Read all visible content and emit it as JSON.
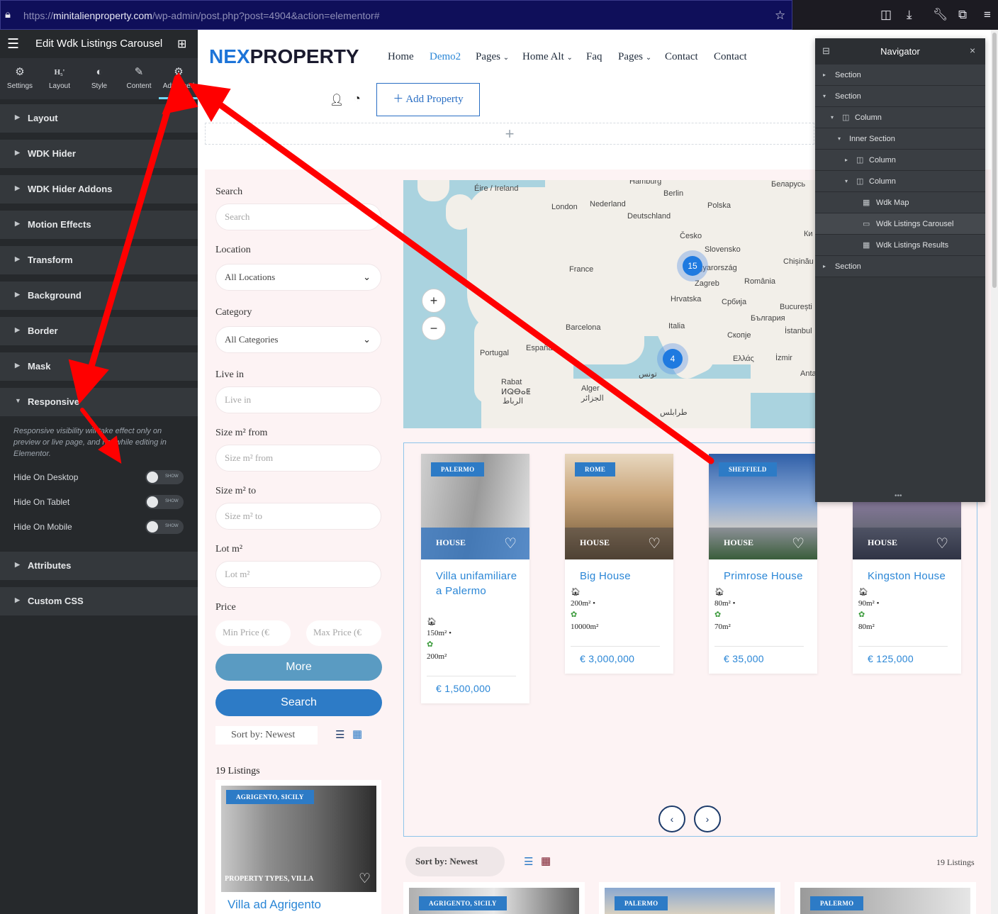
{
  "browser": {
    "url_prefix": "https://",
    "url_domain": "minitalienproperty.com",
    "url_path": "/wp-admin/post.php?post=4904&action=elementor#"
  },
  "panel": {
    "title": "Edit Wdk Listings Carousel",
    "tabs": [
      {
        "label": "Settings",
        "icon": "gears-icon"
      },
      {
        "label": "Layout",
        "icon": "heading-icon"
      },
      {
        "label": "Style",
        "icon": "half-circle-icon"
      },
      {
        "label": "Content",
        "icon": "pencil-icon"
      },
      {
        "label": "Advanced",
        "icon": "gear-icon"
      }
    ],
    "sections": [
      "Layout",
      "WDK Hider",
      "WDK Hider Addons",
      "Motion Effects",
      "Transform",
      "Background",
      "Border",
      "Mask",
      "Responsive",
      "Attributes",
      "Custom CSS"
    ],
    "responsive_note": "Responsive visibility will take effect only on preview or live page, and not while editing in Elementor.",
    "controls": [
      {
        "label": "Hide On Desktop",
        "toggle": "SHOW"
      },
      {
        "label": "Hide On Tablet",
        "toggle": "SHOW"
      },
      {
        "label": "Hide On Mobile",
        "toggle": "SHOW"
      }
    ]
  },
  "site": {
    "logo_a": "NEX",
    "logo_b": "PROPERTY",
    "nav": [
      "Home",
      "Demo2",
      "Pages",
      "Home Alt",
      "Faq",
      "Pages",
      "Contact",
      "Contact"
    ],
    "add_property": "Add Property"
  },
  "filters": {
    "search_label": "Search",
    "search_placeholder": "Search",
    "location_label": "Location",
    "location_value": "All Locations",
    "category_label": "Category",
    "category_value": "All Categories",
    "livein_label": "Live in",
    "livein_placeholder": "Live in",
    "sizefrom_label": "Size m² from",
    "sizefrom_placeholder": "Size m² from",
    "sizeto_label": "Size m² to",
    "sizeto_placeholder": "Size m² to",
    "lot_label": "Lot m²",
    "lot_placeholder": "Lot m²",
    "price_label": "Price",
    "min_price": "Min Price (€",
    "max_price": "Max Price (€",
    "more_button": "More",
    "search_button": "Search",
    "sort": "Sort by: Newest",
    "count": "19 Listings"
  },
  "left_listing": {
    "badge": "AGRIGENTO, SICILY",
    "type": "PROPERTY TYPES, VILLA",
    "title": "Villa ad Agrigento"
  },
  "map": {
    "labels": [
      "Éire / Ireland",
      "Hamburg",
      "Berlin",
      "Беларусь",
      "London",
      "Nederland",
      "Polska",
      "Deutschland",
      "Česko",
      "Slovensko",
      "Chișinău",
      "France",
      "Magyarország",
      "Zagreb",
      "România",
      "Hrvatska",
      "Србија",
      "București",
      "България",
      "Barcelona",
      "Italia",
      "Скопје",
      "İstanbul",
      "Portugal",
      "España",
      "Ελλάς",
      "İzmir",
      "Rabat",
      "ⵍⵕⴱⴰⵟ",
      "الرباط",
      "Alger",
      "الجزائر",
      "تونس",
      "طرابلس",
      "Anta",
      "Ки"
    ],
    "clusters": [
      "15",
      "4"
    ],
    "zoom_in": "+",
    "zoom_out": "−"
  },
  "carousel": {
    "cards": [
      {
        "badge": "PALERMO",
        "type": "HOUSE",
        "title": "Villa unifamiliare a Palermo",
        "size": "150m² •",
        "lot": "200m²",
        "price": "€ 1,500,000"
      },
      {
        "badge": "ROME",
        "type": "HOUSE",
        "title": "Big House",
        "size": "200m² •",
        "lot": "10000m²",
        "price": "€ 3,000,000"
      },
      {
        "badge": "SHEFFIELD",
        "type": "HOUSE",
        "title": "Primrose House",
        "size": "80m² •",
        "lot": "70m²",
        "price": "€ 35,000"
      },
      {
        "badge": "",
        "type": "HOUSE",
        "title": "Kingston House",
        "size": "90m² •",
        "lot": "80m²",
        "price": "€ 125,000"
      }
    ],
    "prev": "‹",
    "next": "›"
  },
  "results": {
    "sort": "Sort by: Newest",
    "count": "19 Listings",
    "badges": [
      "AGRIGENTO, SICILY",
      "PALERMO",
      "PALERMO"
    ]
  },
  "navigator": {
    "title": "Navigator",
    "rows": [
      {
        "label": "Section",
        "arrow": "▸"
      },
      {
        "label": "Section",
        "arrow": "▾"
      },
      {
        "label": "Column",
        "arrow": "▾",
        "icon": "◫"
      },
      {
        "label": "Inner Section",
        "arrow": "▾"
      },
      {
        "label": "Column",
        "arrow": "▸",
        "icon": "◫"
      },
      {
        "label": "Column",
        "arrow": "▾",
        "icon": "◫"
      },
      {
        "label": "Wdk Map",
        "icon": "▦"
      },
      {
        "label": "Wdk Listings Carousel",
        "icon": "▭"
      },
      {
        "label": "Wdk Listings Results",
        "icon": "▦"
      },
      {
        "label": "Section",
        "arrow": "▸"
      }
    ]
  },
  "colors": {
    "annotation_red": "#ff0000",
    "accent_blue": "#2a86d6",
    "panel_dark": "#26292c"
  }
}
